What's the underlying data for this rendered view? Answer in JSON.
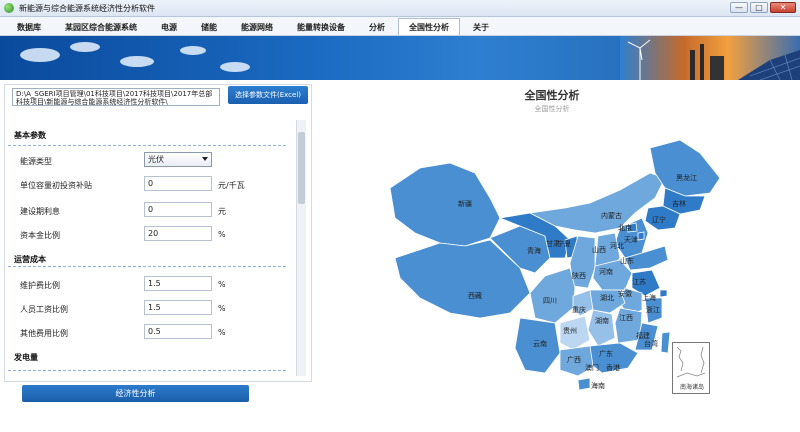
{
  "window": {
    "title": "新能源与综合能源系统经济性分析软件",
    "buttons": {
      "minimize": "—",
      "maximize": "□",
      "close": "✕"
    }
  },
  "menu": {
    "tabs": [
      {
        "label": "数据库"
      },
      {
        "label": "某园区综合能源系统"
      },
      {
        "label": "电源"
      },
      {
        "label": "储能"
      },
      {
        "label": "能源网络"
      },
      {
        "label": "能量转换设备"
      },
      {
        "label": "分析"
      },
      {
        "label": "全国性分析"
      },
      {
        "label": "关于"
      }
    ],
    "active_index": 7
  },
  "left": {
    "path_text": "D:\\A_SGERI项目管理\\01科技项目\\2017科技项目\\2017年总部科技项目\\新能源与综合能源系统经济性分析软件\\",
    "select_file_button": "选择参数文件(Excel)",
    "sections": {
      "basic": "基本参数",
      "operation": "运营成本",
      "generation": "发电量"
    },
    "fields": {
      "energy_type": {
        "label": "能源类型",
        "value": "光伏"
      },
      "subsidy": {
        "label": "单位容量初投资补贴",
        "value": "0",
        "unit": "元/千瓦"
      },
      "interest": {
        "label": "建设期利息",
        "value": "0",
        "unit": "元"
      },
      "capital_ratio": {
        "label": "资本金比例",
        "value": "20",
        "unit": "%"
      },
      "maintenance": {
        "label": "维护费比例",
        "value": "1.5",
        "unit": "%"
      },
      "labor": {
        "label": "人员工资比例",
        "value": "1.5",
        "unit": "%"
      },
      "other": {
        "label": "其他费用比例",
        "value": "0.5",
        "unit": "%"
      }
    },
    "analyze_button": "经济性分析"
  },
  "map": {
    "title": "全国性分析",
    "subtitle": "全国性分析",
    "provinces": {
      "xinjiang": "新疆",
      "xizang": "西藏",
      "qinghai": "青海",
      "gansu": "甘肃",
      "neimenggu": "内蒙古",
      "heilongjiang": "黑龙江",
      "jilin": "吉林",
      "liaoning": "辽宁",
      "beijing": "北京",
      "tianjin": "天津",
      "hebei": "河北",
      "shanxi": "山西",
      "shandong": "山东",
      "ningxia": "宁夏",
      "shaanxi": "陕西",
      "henan": "河南",
      "jiangsu": "江苏",
      "anhui": "安徽",
      "shanghai": "上海",
      "sichuan": "四川",
      "hubei": "湖北",
      "chongqing": "重庆",
      "zhejiang": "浙江",
      "hunan": "湖南",
      "jiangxi": "江西",
      "guizhou": "贵州",
      "fujian": "福建",
      "yunnan": "云南",
      "guangxi": "广西",
      "guangdong": "广东",
      "taiwan": "台湾",
      "hainan": "海南",
      "hongkong": "香港",
      "macau": "澳门"
    },
    "inset_label": "南海诸岛",
    "colors": {
      "dark": "#2f7bc8",
      "mid": "#4a8fd2",
      "light": "#6fa8dd",
      "lighter": "#96c0e8",
      "pale": "#bcd7f1"
    }
  }
}
